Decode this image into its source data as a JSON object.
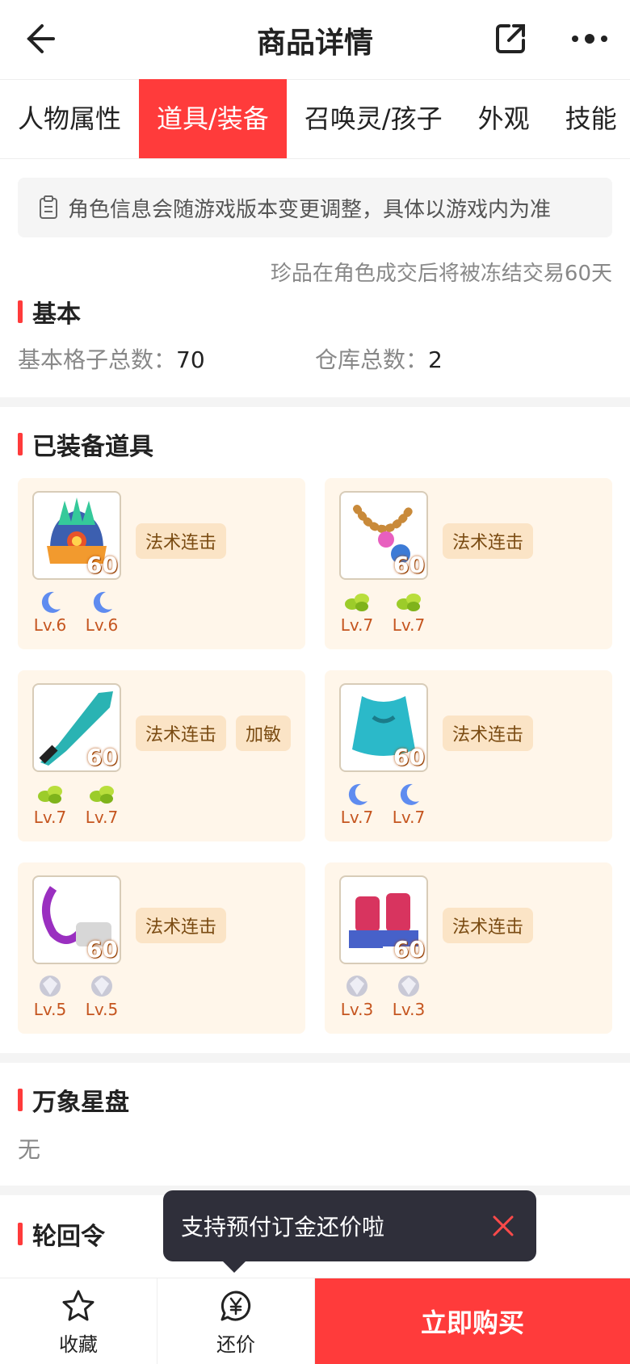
{
  "header": {
    "title": "商品详情"
  },
  "tabs": [
    {
      "label": "人物属性"
    },
    {
      "label": "道具/装备",
      "active": true
    },
    {
      "label": "召唤灵/孩子"
    },
    {
      "label": "外观"
    },
    {
      "label": "技能"
    }
  ],
  "notice": "角色信息会随游戏版本变更调整，具体以游戏内为准",
  "freeze_note": "珍品在角色成交后将被冻结交易60天",
  "basic": {
    "title": "基本",
    "slots_label": "基本格子总数：",
    "slots_value": "70",
    "warehouse_label": "仓库总数：",
    "warehouse_value": "2"
  },
  "equipped": {
    "title": "已装备道具",
    "items": [
      {
        "icon": "helmet",
        "level": "60",
        "tags": [
          "法术连击"
        ],
        "gems": [
          {
            "type": "moon",
            "lv": "Lv.6"
          },
          {
            "type": "moon",
            "lv": "Lv.6"
          }
        ]
      },
      {
        "icon": "necklace",
        "level": "60",
        "tags": [
          "法术连击"
        ],
        "gems": [
          {
            "type": "green",
            "lv": "Lv.7"
          },
          {
            "type": "green",
            "lv": "Lv.7"
          }
        ]
      },
      {
        "icon": "weapon",
        "level": "60",
        "tags": [
          "法术连击",
          "加敏"
        ],
        "gems": [
          {
            "type": "green",
            "lv": "Lv.7"
          },
          {
            "type": "green",
            "lv": "Lv.7"
          }
        ]
      },
      {
        "icon": "armor",
        "level": "60",
        "tags": [
          "法术连击"
        ],
        "gems": [
          {
            "type": "moon",
            "lv": "Lv.7"
          },
          {
            "type": "moon",
            "lv": "Lv.7"
          }
        ]
      },
      {
        "icon": "belt",
        "level": "60",
        "tags": [
          "法术连击"
        ],
        "gems": [
          {
            "type": "diamond",
            "lv": "Lv.5"
          },
          {
            "type": "diamond",
            "lv": "Lv.5"
          }
        ]
      },
      {
        "icon": "boots",
        "level": "60",
        "tags": [
          "法术连击"
        ],
        "gems": [
          {
            "type": "diamond",
            "lv": "Lv.3"
          },
          {
            "type": "diamond",
            "lv": "Lv.3"
          }
        ]
      }
    ]
  },
  "star_disk": {
    "title": "万象星盘",
    "value": "无"
  },
  "reincarnation": {
    "title": "轮回令"
  },
  "toast": {
    "text": "支持预付订金还价啦"
  },
  "bottom": {
    "favorite": "收藏",
    "bargain": "还价",
    "buy": "立即购买"
  },
  "colors": {
    "accent": "#ff3b3b",
    "card_bg": "#fff6ea",
    "tag_bg": "#fbe4c6",
    "gem_level": "#c5551f"
  }
}
